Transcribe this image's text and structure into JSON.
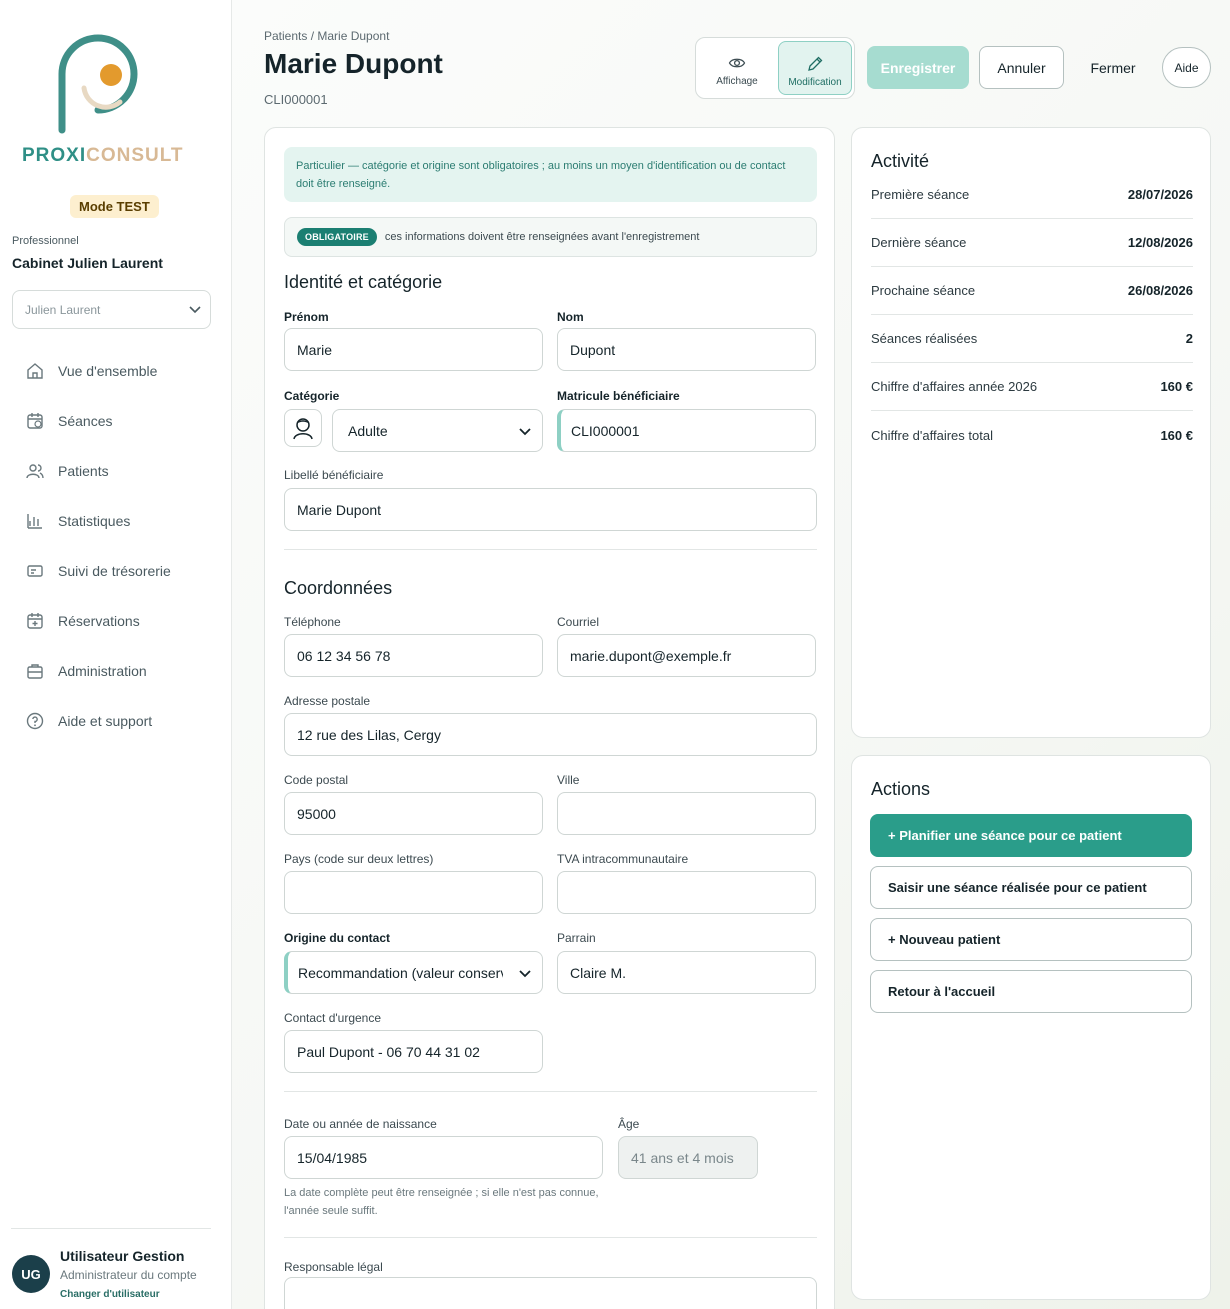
{
  "sidebar": {
    "brand_left": "PROXI",
    "brand_right": "CONSULT",
    "mode_badge": "Mode TEST",
    "pro_label": "Professionnel",
    "pro_name": "Cabinet Julien Laurent",
    "pro_select_value": "Julien Laurent",
    "nav": [
      {
        "label": "Vue d'ensemble",
        "icon": "home-icon"
      },
      {
        "label": "Séances",
        "icon": "calendar-icon"
      },
      {
        "label": "Patients",
        "icon": "users-icon"
      },
      {
        "label": "Statistiques",
        "icon": "chart-icon"
      },
      {
        "label": "Suivi de trésorerie",
        "icon": "card-icon"
      },
      {
        "label": "Réservations",
        "icon": "calendar-plus-icon"
      },
      {
        "label": "Administration",
        "icon": "briefcase-icon"
      },
      {
        "label": "Aide et support",
        "icon": "help-circle-icon"
      }
    ],
    "user": {
      "initials": "UG",
      "name": "Utilisateur Gestion",
      "role": "Administrateur du compte",
      "switch_label": "Changer d'utilisateur"
    }
  },
  "header": {
    "breadcrumb": "Patients / Marie Dupont",
    "title": "Marie Dupont",
    "code": "CLI000001",
    "view_label": "Affichage",
    "edit_label": "Modification",
    "save_label": "Enregistrer",
    "cancel_label": "Annuler",
    "close_label": "Fermer",
    "help_label": "Aide"
  },
  "form": {
    "banner": "Particulier — catégorie et origine sont obligatoires ; au moins un moyen d'identification ou de contact doit être renseigné.",
    "required_pill": "OBLIGATOIRE",
    "required_text": "ces informations doivent être renseignées avant l'enregistrement",
    "section_identity": "Identité et catégorie",
    "prenom_label": "Prénom",
    "prenom_value": "Marie",
    "nom_label": "Nom",
    "nom_value": "Dupont",
    "categorie_label": "Catégorie",
    "categorie_value": "Adulte",
    "matricule_label": "Matricule bénéficiaire",
    "matricule_value": "CLI000001",
    "libelle_label": "Libellé bénéficiaire",
    "libelle_value": "Marie Dupont",
    "section_contact": "Coordonnées",
    "tel_label": "Téléphone",
    "tel_value": "06 12 34 56 78",
    "email_label": "Courriel",
    "email_value": "marie.dupont@exemple.fr",
    "adresse_label": "Adresse postale",
    "adresse_value": "12 rue des Lilas, Cergy",
    "cp_label": "Code postal",
    "cp_value": "95000",
    "ville_label": "Ville",
    "ville_value": "",
    "pays_label": "Pays (code sur deux lettres)",
    "pays_value": "",
    "tva_label": "TVA intracommunautaire",
    "tva_value": "",
    "origine_label": "Origine du contact",
    "origine_value": "Recommandation (valeur conserve",
    "parrain_label": "Parrain",
    "parrain_value": "Claire M.",
    "urgence_label": "Contact d'urgence",
    "urgence_value": "Paul Dupont - 06 70 44 31 02",
    "naissance_label": "Date ou année de naissance",
    "naissance_value": "15/04/1985",
    "age_label": "Âge",
    "age_value": "41 ans et 4 mois",
    "naissance_hint": "La date complète peut être renseignée ; si elle n'est pas connue, l'année seule suffit.",
    "responsable_label": "Responsable légal",
    "responsable_value": ""
  },
  "activity": {
    "title": "Activité",
    "rows": [
      {
        "label": "Première séance",
        "value": "28/07/2026"
      },
      {
        "label": "Dernière séance",
        "value": "12/08/2026"
      },
      {
        "label": "Prochaine séance",
        "value": "26/08/2026"
      },
      {
        "label": "Séances réalisées",
        "value": "2"
      },
      {
        "label": "Chiffre d'affaires année 2026",
        "value": "160 €"
      },
      {
        "label": "Chiffre d'affaires total",
        "value": "160 €"
      }
    ]
  },
  "actions": {
    "title": "Actions",
    "buttons": [
      "+ Planifier une séance pour ce patient",
      "Saisir une séance réalisée pour ce patient",
      "+ Nouveau patient",
      "Retour à l'accueil"
    ]
  },
  "colors": {
    "accent": "#2a9d8a",
    "accent_light": "#a6dcd0",
    "brand_teal": "#2f8f86",
    "brand_sand": "#d8b995",
    "logo_orange": "#e39a2d"
  }
}
